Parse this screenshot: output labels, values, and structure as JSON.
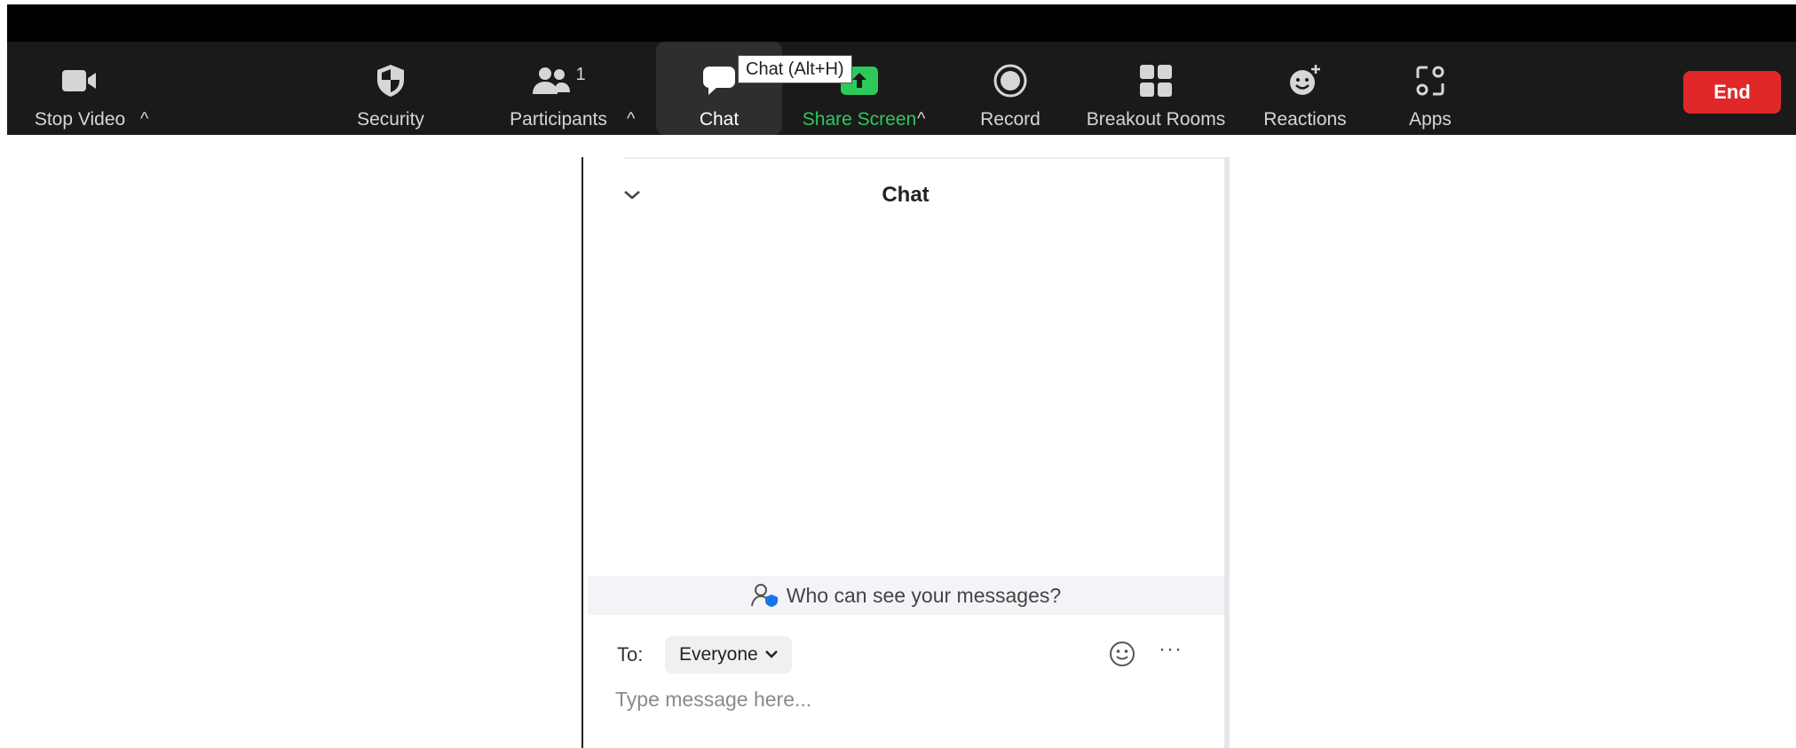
{
  "toolbar": {
    "stop_video": "Stop Video",
    "security": "Security",
    "participants": "Participants",
    "participants_count": "1",
    "chat": "Chat",
    "share_screen": "Share Screen",
    "record": "Record",
    "breakout_rooms": "Breakout Rooms",
    "reactions": "Reactions",
    "apps": "Apps",
    "end": "End",
    "caret": "^"
  },
  "tooltip": "Chat (Alt+H)",
  "chat_panel": {
    "title": "Chat",
    "who_can_see": "Who can see your messages?",
    "to_label": "To:",
    "recipient": "Everyone",
    "more": "···",
    "input_placeholder": "Type message here..."
  },
  "colors": {
    "toolbar_bg": "#1a1a1a",
    "share_green": "#2ec95b",
    "end_red": "#e02828",
    "privacy_icon_blue": "#1a73e8"
  },
  "icons": [
    "video-camera-icon",
    "shield-icon",
    "participants-icon",
    "chat-bubble-icon",
    "share-screen-icon",
    "record-icon",
    "breakout-rooms-icon",
    "reactions-icon",
    "apps-icon",
    "chevron-down-icon",
    "privacy-icon",
    "emoji-icon",
    "more-icon"
  ]
}
